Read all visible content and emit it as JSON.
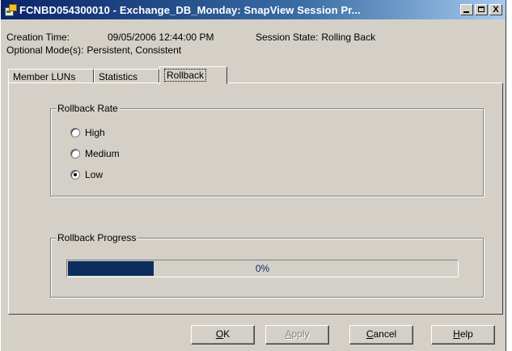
{
  "window": {
    "title": "FCNBD054300010 - Exchange_DB_Monday: SnapView Session Pr...",
    "controls": {
      "minimize": "minimize",
      "maximize": "maximize",
      "close": "X"
    }
  },
  "session": {
    "creation_label": "Creation Time:",
    "creation_value": "09/05/2006 12:44:00 PM",
    "state_label": "Session State:",
    "state_value": "Rolling Back",
    "modes_label": "Optional Mode(s):",
    "modes_value": "Persistent, Consistent"
  },
  "tabs": [
    {
      "label": "Member LUNs",
      "active": false
    },
    {
      "label": "Statistics",
      "active": false
    },
    {
      "label": "Rollback",
      "active": true
    }
  ],
  "rollback_rate": {
    "legend": "Rollback Rate",
    "options": [
      {
        "label": "High",
        "selected": false
      },
      {
        "label": "Medium",
        "selected": false
      },
      {
        "label": "Low",
        "selected": true
      }
    ]
  },
  "rollback_progress": {
    "legend": "Rollback Progress",
    "value_text": "0%",
    "fill_fraction": 0.22,
    "fill_color": "#0b2e5c"
  },
  "buttons": {
    "ok": {
      "mnemonic": "O",
      "rest": "K"
    },
    "apply": {
      "mnemonic": "A",
      "rest": "pply",
      "disabled": true
    },
    "cancel": {
      "mnemonic": "C",
      "rest": "ancel"
    },
    "help": {
      "mnemonic": "H",
      "rest": "elp"
    }
  },
  "icons": [
    "app-icon",
    "minimize-icon",
    "maximize-icon",
    "close-icon",
    "radio-icon"
  ]
}
